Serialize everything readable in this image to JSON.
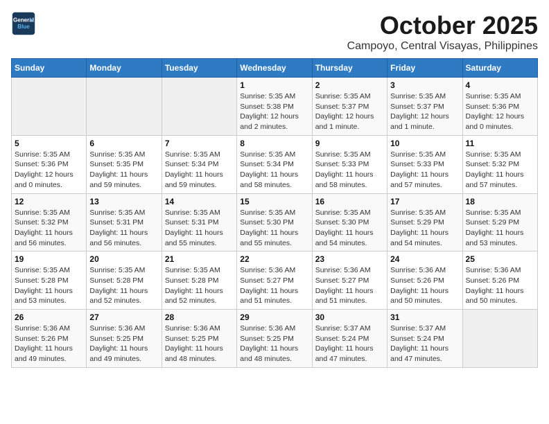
{
  "header": {
    "logo_line1": "General",
    "logo_line2": "Blue",
    "month": "October 2025",
    "location": "Campoyo, Central Visayas, Philippines"
  },
  "weekdays": [
    "Sunday",
    "Monday",
    "Tuesday",
    "Wednesday",
    "Thursday",
    "Friday",
    "Saturday"
  ],
  "rows": [
    [
      {
        "day": "",
        "sunrise": "",
        "sunset": "",
        "daylight": ""
      },
      {
        "day": "",
        "sunrise": "",
        "sunset": "",
        "daylight": ""
      },
      {
        "day": "",
        "sunrise": "",
        "sunset": "",
        "daylight": ""
      },
      {
        "day": "1",
        "sunrise": "Sunrise: 5:35 AM",
        "sunset": "Sunset: 5:38 PM",
        "daylight": "Daylight: 12 hours and 2 minutes."
      },
      {
        "day": "2",
        "sunrise": "Sunrise: 5:35 AM",
        "sunset": "Sunset: 5:37 PM",
        "daylight": "Daylight: 12 hours and 1 minute."
      },
      {
        "day": "3",
        "sunrise": "Sunrise: 5:35 AM",
        "sunset": "Sunset: 5:37 PM",
        "daylight": "Daylight: 12 hours and 1 minute."
      },
      {
        "day": "4",
        "sunrise": "Sunrise: 5:35 AM",
        "sunset": "Sunset: 5:36 PM",
        "daylight": "Daylight: 12 hours and 0 minutes."
      }
    ],
    [
      {
        "day": "5",
        "sunrise": "Sunrise: 5:35 AM",
        "sunset": "Sunset: 5:36 PM",
        "daylight": "Daylight: 12 hours and 0 minutes."
      },
      {
        "day": "6",
        "sunrise": "Sunrise: 5:35 AM",
        "sunset": "Sunset: 5:35 PM",
        "daylight": "Daylight: 11 hours and 59 minutes."
      },
      {
        "day": "7",
        "sunrise": "Sunrise: 5:35 AM",
        "sunset": "Sunset: 5:34 PM",
        "daylight": "Daylight: 11 hours and 59 minutes."
      },
      {
        "day": "8",
        "sunrise": "Sunrise: 5:35 AM",
        "sunset": "Sunset: 5:34 PM",
        "daylight": "Daylight: 11 hours and 58 minutes."
      },
      {
        "day": "9",
        "sunrise": "Sunrise: 5:35 AM",
        "sunset": "Sunset: 5:33 PM",
        "daylight": "Daylight: 11 hours and 58 minutes."
      },
      {
        "day": "10",
        "sunrise": "Sunrise: 5:35 AM",
        "sunset": "Sunset: 5:33 PM",
        "daylight": "Daylight: 11 hours and 57 minutes."
      },
      {
        "day": "11",
        "sunrise": "Sunrise: 5:35 AM",
        "sunset": "Sunset: 5:32 PM",
        "daylight": "Daylight: 11 hours and 57 minutes."
      }
    ],
    [
      {
        "day": "12",
        "sunrise": "Sunrise: 5:35 AM",
        "sunset": "Sunset: 5:32 PM",
        "daylight": "Daylight: 11 hours and 56 minutes."
      },
      {
        "day": "13",
        "sunrise": "Sunrise: 5:35 AM",
        "sunset": "Sunset: 5:31 PM",
        "daylight": "Daylight: 11 hours and 56 minutes."
      },
      {
        "day": "14",
        "sunrise": "Sunrise: 5:35 AM",
        "sunset": "Sunset: 5:31 PM",
        "daylight": "Daylight: 11 hours and 55 minutes."
      },
      {
        "day": "15",
        "sunrise": "Sunrise: 5:35 AM",
        "sunset": "Sunset: 5:30 PM",
        "daylight": "Daylight: 11 hours and 55 minutes."
      },
      {
        "day": "16",
        "sunrise": "Sunrise: 5:35 AM",
        "sunset": "Sunset: 5:30 PM",
        "daylight": "Daylight: 11 hours and 54 minutes."
      },
      {
        "day": "17",
        "sunrise": "Sunrise: 5:35 AM",
        "sunset": "Sunset: 5:29 PM",
        "daylight": "Daylight: 11 hours and 54 minutes."
      },
      {
        "day": "18",
        "sunrise": "Sunrise: 5:35 AM",
        "sunset": "Sunset: 5:29 PM",
        "daylight": "Daylight: 11 hours and 53 minutes."
      }
    ],
    [
      {
        "day": "19",
        "sunrise": "Sunrise: 5:35 AM",
        "sunset": "Sunset: 5:28 PM",
        "daylight": "Daylight: 11 hours and 53 minutes."
      },
      {
        "day": "20",
        "sunrise": "Sunrise: 5:35 AM",
        "sunset": "Sunset: 5:28 PM",
        "daylight": "Daylight: 11 hours and 52 minutes."
      },
      {
        "day": "21",
        "sunrise": "Sunrise: 5:35 AM",
        "sunset": "Sunset: 5:28 PM",
        "daylight": "Daylight: 11 hours and 52 minutes."
      },
      {
        "day": "22",
        "sunrise": "Sunrise: 5:36 AM",
        "sunset": "Sunset: 5:27 PM",
        "daylight": "Daylight: 11 hours and 51 minutes."
      },
      {
        "day": "23",
        "sunrise": "Sunrise: 5:36 AM",
        "sunset": "Sunset: 5:27 PM",
        "daylight": "Daylight: 11 hours and 51 minutes."
      },
      {
        "day": "24",
        "sunrise": "Sunrise: 5:36 AM",
        "sunset": "Sunset: 5:26 PM",
        "daylight": "Daylight: 11 hours and 50 minutes."
      },
      {
        "day": "25",
        "sunrise": "Sunrise: 5:36 AM",
        "sunset": "Sunset: 5:26 PM",
        "daylight": "Daylight: 11 hours and 50 minutes."
      }
    ],
    [
      {
        "day": "26",
        "sunrise": "Sunrise: 5:36 AM",
        "sunset": "Sunset: 5:26 PM",
        "daylight": "Daylight: 11 hours and 49 minutes."
      },
      {
        "day": "27",
        "sunrise": "Sunrise: 5:36 AM",
        "sunset": "Sunset: 5:25 PM",
        "daylight": "Daylight: 11 hours and 49 minutes."
      },
      {
        "day": "28",
        "sunrise": "Sunrise: 5:36 AM",
        "sunset": "Sunset: 5:25 PM",
        "daylight": "Daylight: 11 hours and 48 minutes."
      },
      {
        "day": "29",
        "sunrise": "Sunrise: 5:36 AM",
        "sunset": "Sunset: 5:25 PM",
        "daylight": "Daylight: 11 hours and 48 minutes."
      },
      {
        "day": "30",
        "sunrise": "Sunrise: 5:37 AM",
        "sunset": "Sunset: 5:24 PM",
        "daylight": "Daylight: 11 hours and 47 minutes."
      },
      {
        "day": "31",
        "sunrise": "Sunrise: 5:37 AM",
        "sunset": "Sunset: 5:24 PM",
        "daylight": "Daylight: 11 hours and 47 minutes."
      },
      {
        "day": "",
        "sunrise": "",
        "sunset": "",
        "daylight": ""
      }
    ]
  ]
}
